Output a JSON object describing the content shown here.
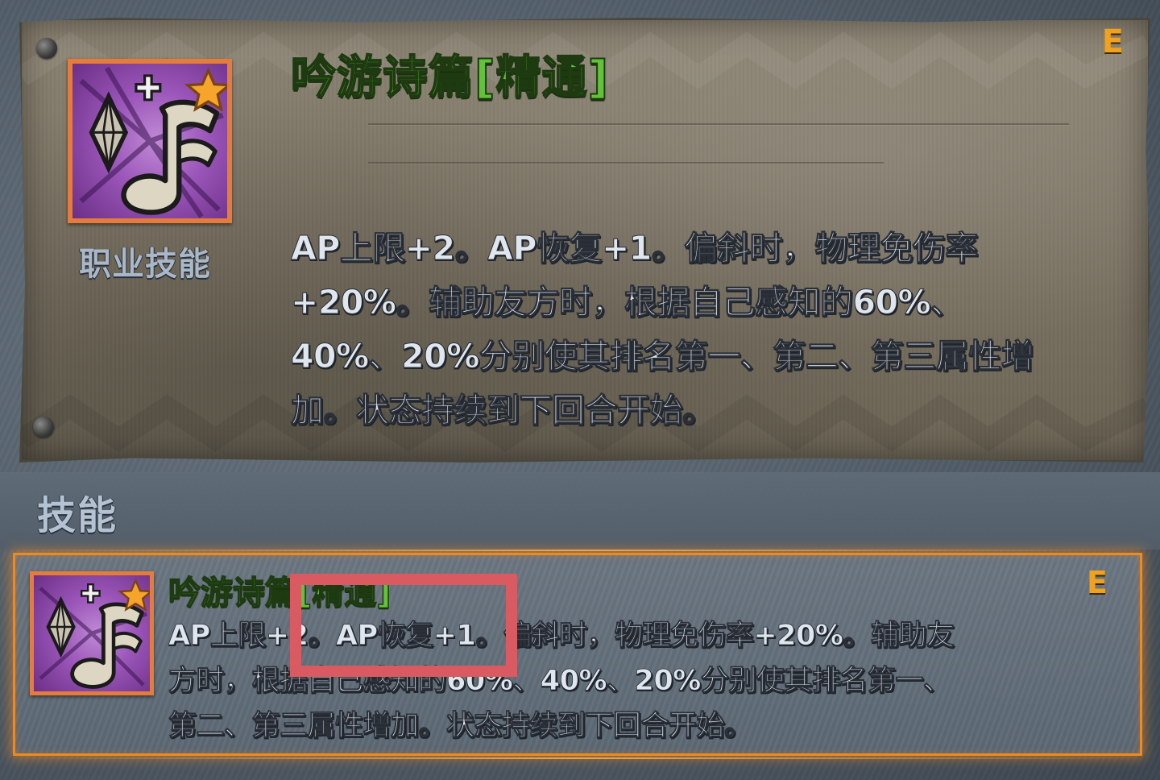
{
  "detail_card": {
    "title": "吟游诗篇[精通]",
    "grade": "E",
    "category_label": "职业技能",
    "description": "AP上限+2。AP恢复+1。偏斜时，物理免伤率+20%。辅助友方时，根据自己感知的60%、40%、20%分别使其排名第一、第二、第三属性增加。状态持续到下回合开始。",
    "icon": "bard-music-note-skill-icon"
  },
  "section": {
    "title": "技能"
  },
  "skill_list": {
    "items": [
      {
        "title": "吟游诗篇[精通]",
        "grade": "E",
        "description": "AP上限+2。AP恢复+1。偏斜时，物理免伤率+20%。辅助友方时，根据自己感知的60%、40%、20%分别使其排名第一、第二、第三属性增加。状态持续到下回合开始。",
        "icon": "bard-music-note-skill-icon",
        "selected": true
      }
    ]
  },
  "colors": {
    "title_green": "#62c23a",
    "grade_orange": "#f0a21e",
    "icon_frame": "#e57c3b",
    "selection_glow": "#f08a1c",
    "annotation_red": "#d95a60"
  }
}
